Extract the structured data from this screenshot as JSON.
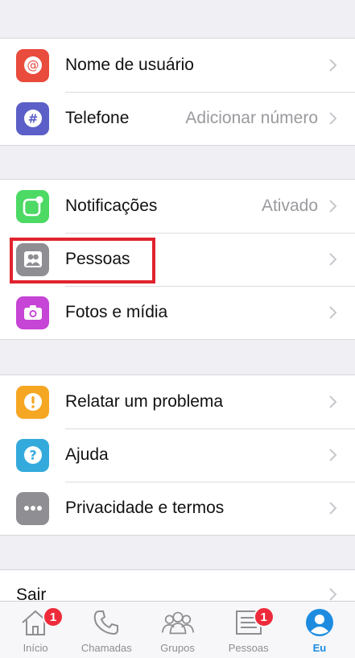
{
  "account_group": [
    {
      "label": "Nome de usuário",
      "value": "",
      "icon": "at-sign-icon",
      "color": "#e94b3c"
    },
    {
      "label": "Telefone",
      "value": "Adicionar número",
      "icon": "hash-icon",
      "color": "#5b5fc7"
    }
  ],
  "settings_group": [
    {
      "label": "Notificações",
      "value": "Ativado",
      "icon": "notification-icon",
      "color": "#4cd964"
    },
    {
      "label": "Pessoas",
      "value": "",
      "icon": "people-icon",
      "color": "#8e8e93"
    },
    {
      "label": "Fotos e mídia",
      "value": "",
      "icon": "camera-icon",
      "color": "#c644d6"
    }
  ],
  "support_group": [
    {
      "label": "Relatar um problema",
      "value": "",
      "icon": "exclamation-icon",
      "color": "#f5a623"
    },
    {
      "label": "Ajuda",
      "value": "",
      "icon": "question-icon",
      "color": "#34aadc"
    },
    {
      "label": "Privacidade e termos",
      "value": "",
      "icon": "more-dots-icon",
      "color": "#8e8e93"
    }
  ],
  "signout": {
    "label": "Sair"
  },
  "tabbar": {
    "tabs": [
      {
        "label": "Início",
        "icon": "home-icon",
        "badge": "1",
        "active": false
      },
      {
        "label": "Chamadas",
        "icon": "phone-icon",
        "badge": "",
        "active": false
      },
      {
        "label": "Grupos",
        "icon": "groups-icon",
        "badge": "",
        "active": false
      },
      {
        "label": "Pessoas",
        "icon": "contacts-list-icon",
        "badge": "1",
        "active": false
      },
      {
        "label": "Eu",
        "icon": "profile-icon",
        "badge": "",
        "active": true
      }
    ]
  },
  "colors": {
    "accent": "#1d8ce0",
    "badge": "#ee2b3a",
    "highlight": "#e0232e"
  }
}
